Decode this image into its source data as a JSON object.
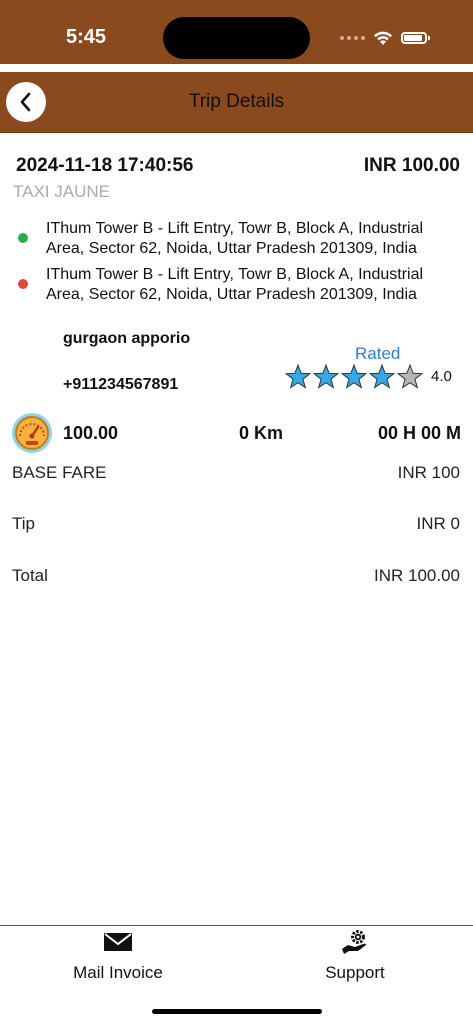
{
  "status_bar": {
    "time": "5:45"
  },
  "header": {
    "title": "Trip Details"
  },
  "trip": {
    "datetime": "2024-11-18 17:40:56",
    "amount": "INR 100.00",
    "vehicle_type": "TAXI JAUNE",
    "pickup_address": "IThum Tower B - Lift Entry, Towr B, Block A, Industrial Area, Sector 62, Noida, Uttar Pradesh 201309, India",
    "drop_address": "IThum Tower B - Lift Entry, Towr B, Block A, Industrial Area, Sector 62, Noida, Uttar Pradesh 201309, India"
  },
  "driver": {
    "name": "gurgaon apporio",
    "phone": "+911234567891",
    "rated_label": "Rated",
    "rating_text": "4.0",
    "rating_value": 4,
    "rating_max": 5
  },
  "stats": {
    "fare": "100.00",
    "distance": "0 Km",
    "duration": "00 H 00 M"
  },
  "fare_breakdown": [
    {
      "label": "BASE FARE",
      "value": "INR 100"
    },
    {
      "label": "Tip",
      "value": "INR 0"
    },
    {
      "label": "Total",
      "value": "INR 100.00"
    }
  ],
  "bottom_bar": {
    "mail_label": "Mail Invoice",
    "support_label": "Support"
  },
  "colors": {
    "brand": "#8B4A1E",
    "pickup_dot": "#2DAA4F",
    "drop_dot": "#E0483A",
    "rated": "#2E7ED6",
    "star_filled": "#35A9E8",
    "star_empty": "#B5B5B5"
  },
  "icons": {
    "back": "chevron-left-icon",
    "meter": "speedometer-icon",
    "mail": "envelope-icon",
    "support": "hand-gear-icon"
  }
}
